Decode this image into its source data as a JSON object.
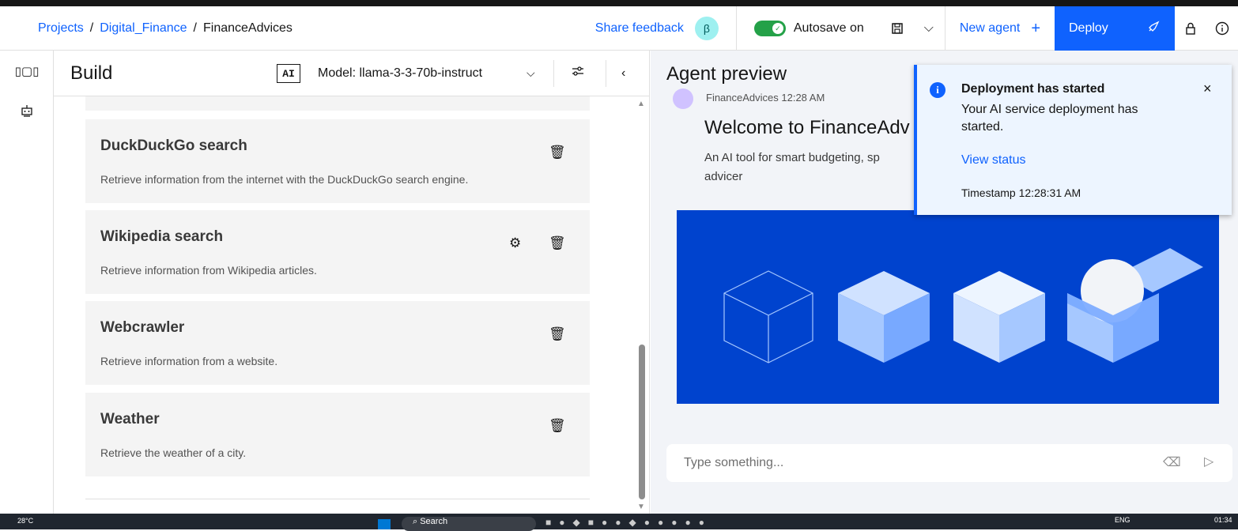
{
  "header": {
    "breadcrumb": [
      "Projects",
      "Digital_Finance",
      "FinanceAdvices"
    ],
    "share_feedback": "Share feedback",
    "beta_badge": "β",
    "autosave_label": "Autosave on",
    "new_agent_label": "New agent",
    "deploy_label": "Deploy"
  },
  "build": {
    "title": "Build",
    "ai_badge": "AI",
    "model_label": "Model: llama-3-3-70b-instruct",
    "tools": [
      {
        "name": "DuckDuckGo search",
        "description": "Retrieve information from the internet with the DuckDuckGo search engine.",
        "has_settings": false
      },
      {
        "name": "Wikipedia search",
        "description": "Retrieve information from Wikipedia articles.",
        "has_settings": true
      },
      {
        "name": "Webcrawler",
        "description": "Retrieve information from a website.",
        "has_settings": false
      },
      {
        "name": "Weather",
        "description": "Retrieve the weather of a city.",
        "has_settings": false
      }
    ]
  },
  "preview": {
    "title": "Agent preview",
    "message_meta": "FinanceAdvices 12:28 AM",
    "welcome": "Welcome to FinanceAdv",
    "description": "An AI tool for smart budgeting, sp advicer",
    "input_placeholder": "Type something..."
  },
  "toast": {
    "title": "Deployment has started",
    "subtitle": "Your AI service deployment has started.",
    "link": "View status",
    "timestamp": "Timestamp 12:28:31 AM"
  },
  "taskbar": {
    "weather": "28°C",
    "search": "Search",
    "lang": "ENG",
    "time": "01:34"
  },
  "colors": {
    "accent": "#0f62fe",
    "success": "#24a148",
    "image_bg": "#0043ce"
  }
}
